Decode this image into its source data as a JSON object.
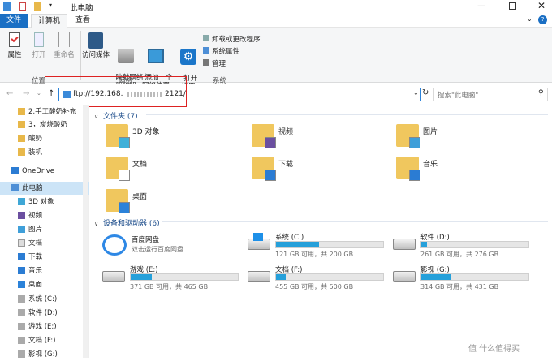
{
  "window": {
    "title": "此电脑",
    "buttons": [
      "minimize",
      "maximize",
      "close"
    ]
  },
  "menu": {
    "file": "文件",
    "computer": "计算机",
    "view": "查看"
  },
  "ribbon": {
    "location": {
      "label": "位置",
      "buttons": [
        "属性",
        "打开",
        "重命名"
      ]
    },
    "network": {
      "label": "网络",
      "buttons": [
        "访问媒体",
        "映射网络\n驱动器",
        "添加一个\n网络位置"
      ]
    },
    "system": {
      "label": "系统",
      "open": "打开\n设置",
      "links": [
        "卸载或更改程序",
        "系统属性",
        "管理"
      ]
    }
  },
  "address": {
    "value": "ftp://192.168.",
    "value2": "2121/",
    "placeholder": "搜索\"此电脑\""
  },
  "sidebar": {
    "items": [
      {
        "label": "2,手工酸奶补充",
        "icon": "folder-icon"
      },
      {
        "label": "3，炭烧酸奶",
        "icon": "folder-icon"
      },
      {
        "label": "酸奶",
        "icon": "folder-icon"
      },
      {
        "label": "装机",
        "icon": "folder-icon"
      },
      {
        "label": "OneDrive",
        "icon": "cloud-icon"
      },
      {
        "label": "此电脑",
        "icon": "pc-icon"
      },
      {
        "label": "3D 对象",
        "icon": "3d-icon"
      },
      {
        "label": "视频",
        "icon": "video-icon"
      },
      {
        "label": "图片",
        "icon": "picture-icon"
      },
      {
        "label": "文档",
        "icon": "document-icon"
      },
      {
        "label": "下载",
        "icon": "download-icon"
      },
      {
        "label": "音乐",
        "icon": "music-icon"
      },
      {
        "label": "桌面",
        "icon": "desktop-icon"
      },
      {
        "label": "系统 (C:)",
        "icon": "drive-icon"
      },
      {
        "label": "软件 (D:)",
        "icon": "drive-icon"
      },
      {
        "label": "游戏 (E:)",
        "icon": "drive-icon"
      },
      {
        "label": "文档 (F:)",
        "icon": "drive-icon"
      },
      {
        "label": "影视 (G:)",
        "icon": "drive-icon"
      }
    ]
  },
  "folders": {
    "header": "文件夹 (7)",
    "items": [
      "3D 对象",
      "视频",
      "图片",
      "文档",
      "下载",
      "音乐",
      "桌面"
    ]
  },
  "devices": {
    "header": "设备和驱动器 (6)",
    "app": {
      "name": "百度网盘",
      "sub": "双击运行百度网盘"
    },
    "drives": [
      {
        "name": "系统 (C:)",
        "info": "121 GB 可用，共 200 GB",
        "fill": 0.4
      },
      {
        "name": "软件 (D:)",
        "info": "261 GB 可用，共 276 GB",
        "fill": 0.05
      },
      {
        "name": "游戏 (E:)",
        "info": "371 GB 可用，共 465 GB",
        "fill": 0.2
      },
      {
        "name": "文档 (F:)",
        "info": "455 GB 可用，共 500 GB",
        "fill": 0.09
      },
      {
        "name": "影视 (G:)",
        "info": "314 GB 可用，共 431 GB",
        "fill": 0.27
      }
    ]
  },
  "watermark": "值 什么值得买"
}
